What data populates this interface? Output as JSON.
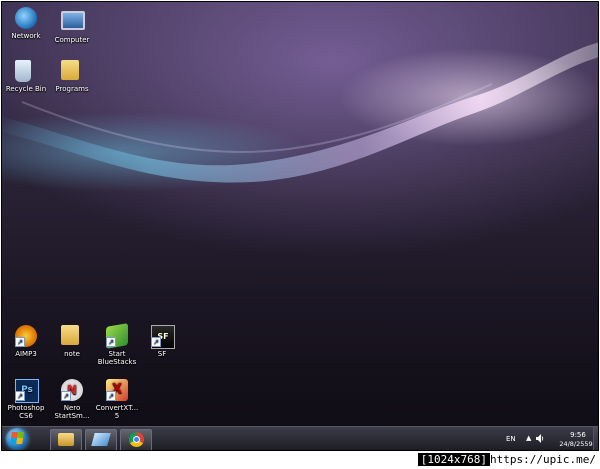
{
  "desktop": {
    "icons_top": [
      {
        "label": "Network",
        "icon": "network-icon"
      },
      {
        "label": "Computer",
        "icon": "computer-icon"
      },
      {
        "label": "Recycle Bin",
        "icon": "recycle-bin-icon"
      },
      {
        "label": "Programs",
        "icon": "folder-icon"
      }
    ],
    "icons_bottom": [
      {
        "label": "AIMP3",
        "icon": "aimp-icon"
      },
      {
        "label": "note",
        "icon": "folder-icon"
      },
      {
        "label": "Start\nBlueStacks",
        "icon": "bluestacks-icon"
      },
      {
        "label": "SF",
        "icon": "sf-icon",
        "glyph": "SF"
      },
      {
        "label": "Photoshop\nCS6",
        "icon": "photoshop-icon",
        "glyph": "Ps"
      },
      {
        "label": "Nero\nStartSm...",
        "icon": "nero-icon",
        "glyph": "N"
      },
      {
        "label": "ConvertXT...\n5",
        "icon": "convertx-icon",
        "glyph": "X"
      }
    ]
  },
  "taskbar": {
    "start_button": "start-orb",
    "pinned": [
      "windows-explorer-icon",
      "task-window-icon",
      "chrome-icon"
    ],
    "tray": {
      "language": "EN",
      "expand_glyph": "▲",
      "time": "9:56",
      "date": "24/8/2559"
    }
  },
  "watermark": {
    "size": "[1024x768]",
    "url": "https://upic.me/"
  },
  "colors": {
    "taskbar": "#1c1c24",
    "wallpaper_dark": "#0d0b12",
    "wallpaper_light": "#b8a2cf"
  }
}
